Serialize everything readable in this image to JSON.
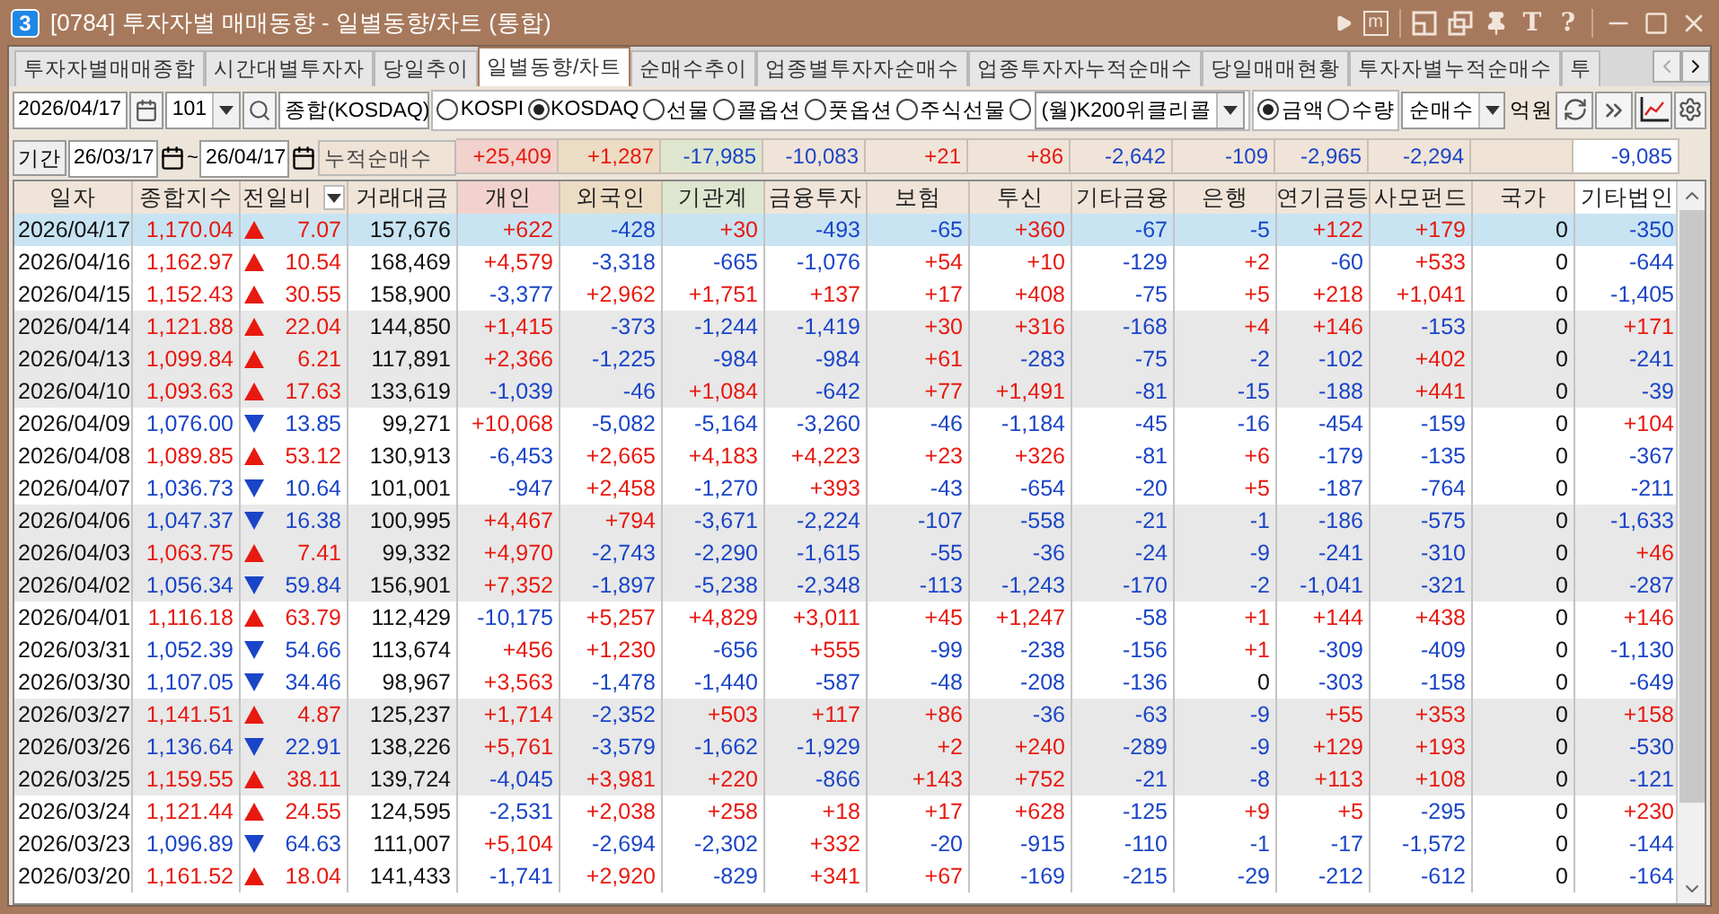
{
  "window": {
    "badge": "3",
    "title": "[0784] 투자자별 매매동향 - 일별동향/차트 (통합)",
    "glyphs": [
      "m",
      "T",
      "?"
    ]
  },
  "tabs": [
    {
      "label": "투자자별매매종합",
      "selected": false
    },
    {
      "label": "시간대별투자자",
      "selected": false
    },
    {
      "label": "당일추이",
      "selected": false
    },
    {
      "label": "일별동향/차트",
      "selected": true
    },
    {
      "label": "순매수추이",
      "selected": false
    },
    {
      "label": "업종별투자자순매수",
      "selected": false
    },
    {
      "label": "업종투자자누적순매수",
      "selected": false
    },
    {
      "label": "당일매매현황",
      "selected": false
    },
    {
      "label": "투자자별누적순매수",
      "selected": false
    },
    {
      "label": "투",
      "selected": false
    }
  ],
  "controls": {
    "date": "2026/04/17",
    "code": "101",
    "name": "종합(KOSDAQ)",
    "markets": [
      {
        "kind": "plain",
        "label": "KOSPI",
        "selected": false
      },
      {
        "kind": "plain",
        "label": "KOSDAQ",
        "selected": true
      },
      {
        "kind": "plain",
        "label": "선물",
        "selected": false
      },
      {
        "kind": "plain",
        "label": "콜옵션",
        "selected": false
      },
      {
        "kind": "plain",
        "label": "풋옵션",
        "selected": false
      },
      {
        "kind": "plain",
        "label": "주식선물",
        "selected": false
      },
      {
        "kind": "dropdown",
        "value": "(월)K200위클리콜",
        "selected": false
      }
    ],
    "units": [
      {
        "label": "금액",
        "selected": true
      },
      {
        "label": "수량",
        "selected": false
      }
    ],
    "mode": "순매수",
    "unit_label": "억원"
  },
  "summary": {
    "period_button": "기간",
    "from": "26/03/17",
    "separator": "~",
    "to": "26/04/17",
    "label": "누적순매수",
    "totals": [
      "+25,409",
      "+1,287",
      "-17,985",
      "-10,083",
      "+21",
      "+86",
      "-2,642",
      "-109",
      "-2,965",
      "-2,294"
    ],
    "other_corp": "-9,085"
  },
  "columns": [
    {
      "label": "일자",
      "color": "#f0e4d8"
    },
    {
      "label": "종합지수",
      "color": "#f0e4d8"
    },
    {
      "label": "전일비",
      "color": "#f0e4d8"
    },
    {
      "label": "거래대금",
      "color": "#f0e4d8"
    },
    {
      "label": "개인",
      "color": "#f2d2cc"
    },
    {
      "label": "외국인",
      "color": "#ecdcc4"
    },
    {
      "label": "기관계",
      "color": "#dfe6cf"
    },
    {
      "label": "금융투자",
      "color": "#f0e4d8"
    },
    {
      "label": "보험",
      "color": "#f0e4d8"
    },
    {
      "label": "투신",
      "color": "#f0e4d8"
    },
    {
      "label": "기타금융",
      "color": "#f0e4d8"
    },
    {
      "label": "은행",
      "color": "#f0e4d8"
    },
    {
      "label": "연기금등",
      "color": "#f0e4d8"
    },
    {
      "label": "사모펀드",
      "color": "#f0e4d8"
    },
    {
      "label": "국가",
      "color": "#f0e4d8"
    },
    {
      "label": "기타법인",
      "color": "#ffffff"
    }
  ],
  "rows": [
    {
      "selected": true,
      "date": "2026/04/17",
      "index": "1,170.04",
      "rising": true,
      "change": "7.07",
      "volume": "157,676",
      "values": [
        "+622",
        "-428",
        "+30",
        "-493",
        "-65",
        "+360",
        "-67",
        "-5",
        "+122",
        "+179",
        "0",
        "-350"
      ]
    },
    {
      "selected": false,
      "date": "2026/04/16",
      "index": "1,162.97",
      "rising": true,
      "change": "10.54",
      "volume": "168,469",
      "values": [
        "+4,579",
        "-3,318",
        "-665",
        "-1,076",
        "+54",
        "+10",
        "-129",
        "+2",
        "-60",
        "+533",
        "0",
        "-644"
      ]
    },
    {
      "selected": false,
      "date": "2026/04/15",
      "index": "1,152.43",
      "rising": true,
      "change": "30.55",
      "volume": "158,900",
      "values": [
        "-3,377",
        "+2,962",
        "+1,751",
        "+137",
        "+17",
        "+408",
        "-75",
        "+5",
        "+218",
        "+1,041",
        "0",
        "-1,405"
      ]
    },
    {
      "selected": false,
      "date": "2026/04/14",
      "index": "1,121.88",
      "rising": true,
      "change": "22.04",
      "volume": "144,850",
      "values": [
        "+1,415",
        "-373",
        "-1,244",
        "-1,419",
        "+30",
        "+316",
        "-168",
        "+4",
        "+146",
        "-153",
        "0",
        "+171"
      ]
    },
    {
      "selected": false,
      "date": "2026/04/13",
      "index": "1,099.84",
      "rising": true,
      "change": "6.21",
      "volume": "117,891",
      "values": [
        "+2,366",
        "-1,225",
        "-984",
        "-984",
        "+61",
        "-283",
        "-75",
        "-2",
        "-102",
        "+402",
        "0",
        "-241"
      ]
    },
    {
      "selected": false,
      "date": "2026/04/10",
      "index": "1,093.63",
      "rising": true,
      "change": "17.63",
      "volume": "133,619",
      "values": [
        "-1,039",
        "-46",
        "+1,084",
        "-642",
        "+77",
        "+1,491",
        "-81",
        "-15",
        "-188",
        "+441",
        "0",
        "-39"
      ]
    },
    {
      "selected": false,
      "date": "2026/04/09",
      "index": "1,076.00",
      "rising": false,
      "change": "13.85",
      "volume": "99,271",
      "values": [
        "+10,068",
        "-5,082",
        "-5,164",
        "-3,260",
        "-46",
        "-1,184",
        "-45",
        "-16",
        "-454",
        "-159",
        "0",
        "+104"
      ]
    },
    {
      "selected": false,
      "date": "2026/04/08",
      "index": "1,089.85",
      "rising": true,
      "change": "53.12",
      "volume": "130,913",
      "values": [
        "-6,453",
        "+2,665",
        "+4,183",
        "+4,223",
        "+23",
        "+326",
        "-81",
        "+6",
        "-179",
        "-135",
        "0",
        "-367"
      ]
    },
    {
      "selected": false,
      "date": "2026/04/07",
      "index": "1,036.73",
      "rising": false,
      "change": "10.64",
      "volume": "101,001",
      "values": [
        "-947",
        "+2,458",
        "-1,270",
        "+393",
        "-43",
        "-654",
        "-20",
        "+5",
        "-187",
        "-764",
        "0",
        "-211"
      ]
    },
    {
      "selected": false,
      "date": "2026/04/06",
      "index": "1,047.37",
      "rising": false,
      "change": "16.38",
      "volume": "100,995",
      "values": [
        "+4,467",
        "+794",
        "-3,671",
        "-2,224",
        "-107",
        "-558",
        "-21",
        "-1",
        "-186",
        "-575",
        "0",
        "-1,633"
      ]
    },
    {
      "selected": false,
      "date": "2026/04/03",
      "index": "1,063.75",
      "rising": true,
      "change": "7.41",
      "volume": "99,332",
      "values": [
        "+4,970",
        "-2,743",
        "-2,290",
        "-1,615",
        "-55",
        "-36",
        "-24",
        "-9",
        "-241",
        "-310",
        "0",
        "+46"
      ]
    },
    {
      "selected": false,
      "date": "2026/04/02",
      "index": "1,056.34",
      "rising": false,
      "change": "59.84",
      "volume": "156,901",
      "values": [
        "+7,352",
        "-1,897",
        "-5,238",
        "-2,348",
        "-113",
        "-1,243",
        "-170",
        "-2",
        "-1,041",
        "-321",
        "0",
        "-287"
      ]
    },
    {
      "selected": false,
      "date": "2026/04/01",
      "index": "1,116.18",
      "rising": true,
      "change": "63.79",
      "volume": "112,429",
      "values": [
        "-10,175",
        "+5,257",
        "+4,829",
        "+3,011",
        "+45",
        "+1,247",
        "-58",
        "+1",
        "+144",
        "+438",
        "0",
        "+146"
      ]
    },
    {
      "selected": false,
      "date": "2026/03/31",
      "index": "1,052.39",
      "rising": false,
      "change": "54.66",
      "volume": "113,674",
      "values": [
        "+456",
        "+1,230",
        "-656",
        "+555",
        "-99",
        "-238",
        "-156",
        "+1",
        "-309",
        "-409",
        "0",
        "-1,130"
      ]
    },
    {
      "selected": false,
      "date": "2026/03/30",
      "index": "1,107.05",
      "rising": false,
      "change": "34.46",
      "volume": "98,967",
      "values": [
        "+3,563",
        "-1,478",
        "-1,440",
        "-587",
        "-48",
        "-208",
        "-136",
        "0",
        "-303",
        "-158",
        "0",
        "-649"
      ]
    },
    {
      "selected": false,
      "date": "2026/03/27",
      "index": "1,141.51",
      "rising": true,
      "change": "4.87",
      "volume": "125,237",
      "values": [
        "+1,714",
        "-2,352",
        "+503",
        "+117",
        "+86",
        "-36",
        "-63",
        "-9",
        "+55",
        "+353",
        "0",
        "+158"
      ]
    },
    {
      "selected": false,
      "date": "2026/03/26",
      "index": "1,136.64",
      "rising": false,
      "change": "22.91",
      "volume": "138,226",
      "values": [
        "+5,761",
        "-3,579",
        "-1,662",
        "-1,929",
        "+2",
        "+240",
        "-289",
        "-9",
        "+129",
        "+193",
        "0",
        "-530"
      ]
    },
    {
      "selected": false,
      "date": "2026/03/25",
      "index": "1,159.55",
      "rising": true,
      "change": "38.11",
      "volume": "139,724",
      "values": [
        "-4,045",
        "+3,981",
        "+220",
        "-866",
        "+143",
        "+752",
        "-21",
        "-8",
        "+113",
        "+108",
        "0",
        "-121"
      ]
    },
    {
      "selected": false,
      "date": "2026/03/24",
      "index": "1,121.44",
      "rising": true,
      "change": "24.55",
      "volume": "124,595",
      "values": [
        "-2,531",
        "+2,038",
        "+258",
        "+18",
        "+17",
        "+628",
        "-125",
        "+9",
        "+5",
        "-295",
        "0",
        "+230"
      ]
    },
    {
      "selected": false,
      "date": "2026/03/23",
      "index": "1,096.89",
      "rising": false,
      "change": "64.63",
      "volume": "111,007",
      "values": [
        "+5,104",
        "-2,694",
        "-2,302",
        "+332",
        "-20",
        "-915",
        "-110",
        "-1",
        "-17",
        "-1,572",
        "0",
        "-144"
      ]
    },
    {
      "selected": false,
      "date": "2026/03/20",
      "index": "1,161.52",
      "rising": true,
      "change": "18.04",
      "volume": "141,433",
      "values": [
        "-1,741",
        "+2,920",
        "-829",
        "+341",
        "+67",
        "-169",
        "-215",
        "-29",
        "-212",
        "-612",
        "0",
        "-164"
      ]
    }
  ]
}
